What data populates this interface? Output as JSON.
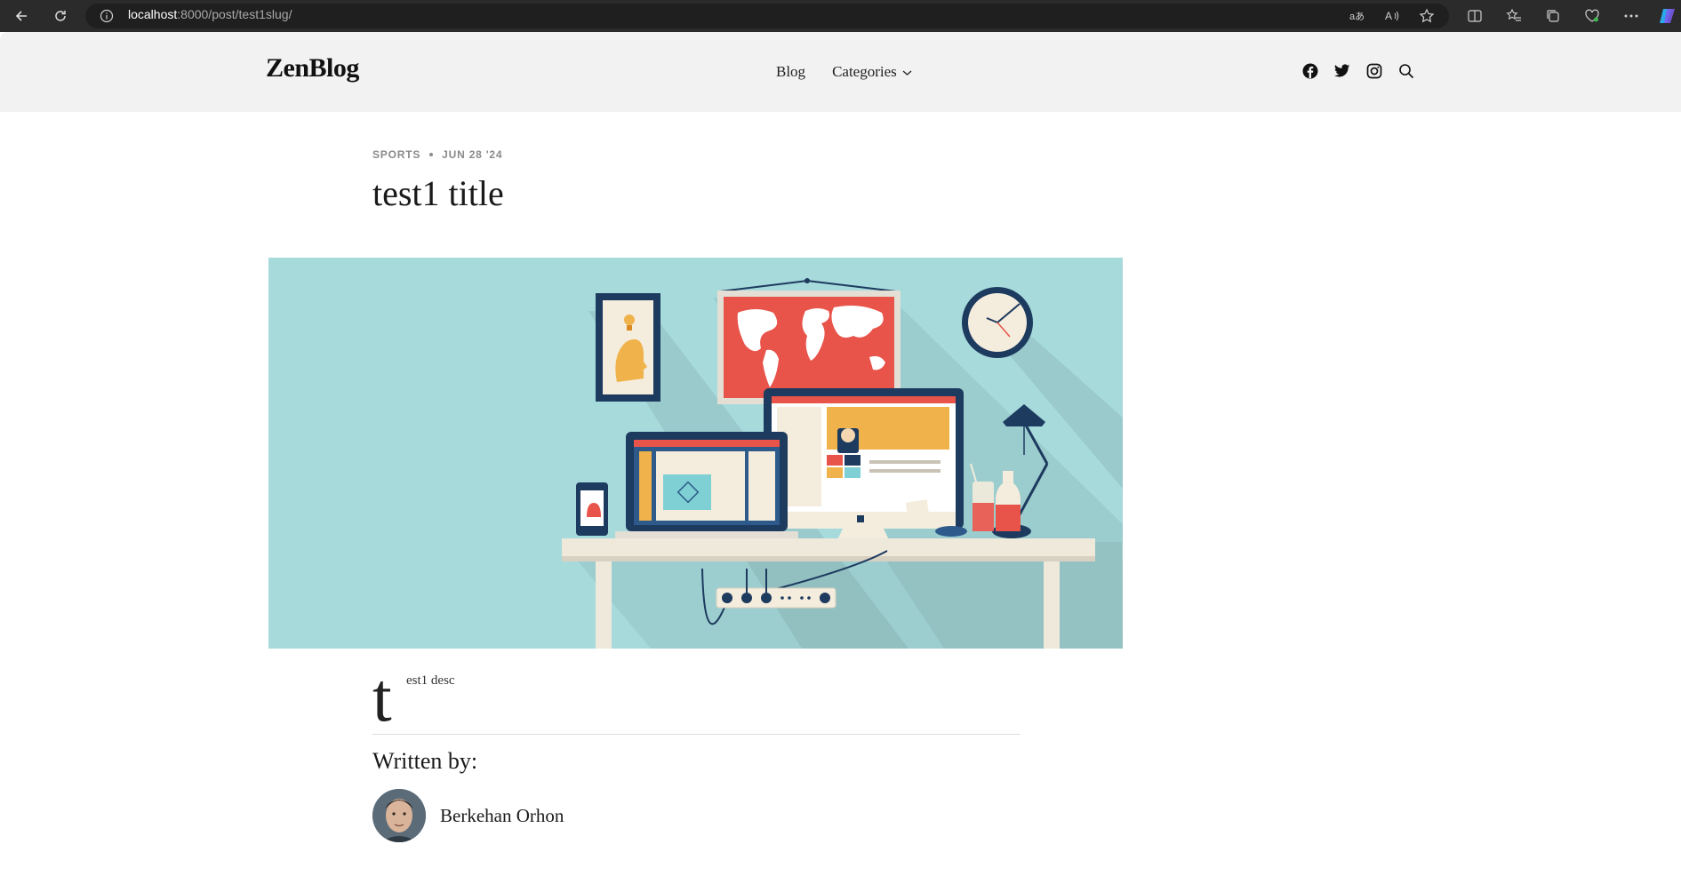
{
  "browser": {
    "url_host": "localhost",
    "url_path": ":8000/post/test1slug/"
  },
  "site": {
    "logo": "ZenBlog",
    "menu": [
      {
        "label": "Blog"
      },
      {
        "label": "Categories"
      }
    ],
    "social_icons": [
      "facebook-icon",
      "twitter-icon",
      "instagram-icon",
      "search-icon"
    ]
  },
  "post": {
    "category": "SPORTS",
    "date": "JUN 28 '24",
    "title": "test1 title",
    "desc_dropcap": "t",
    "desc_rest": "est1 desc",
    "written_by_label": "Written by:",
    "author_name": "Berkehan Orhon"
  },
  "colors": {
    "header_bg": "#f2f2f2",
    "hero_bg": "#a6dadb",
    "browser_chrome": "#2b2b2b"
  }
}
